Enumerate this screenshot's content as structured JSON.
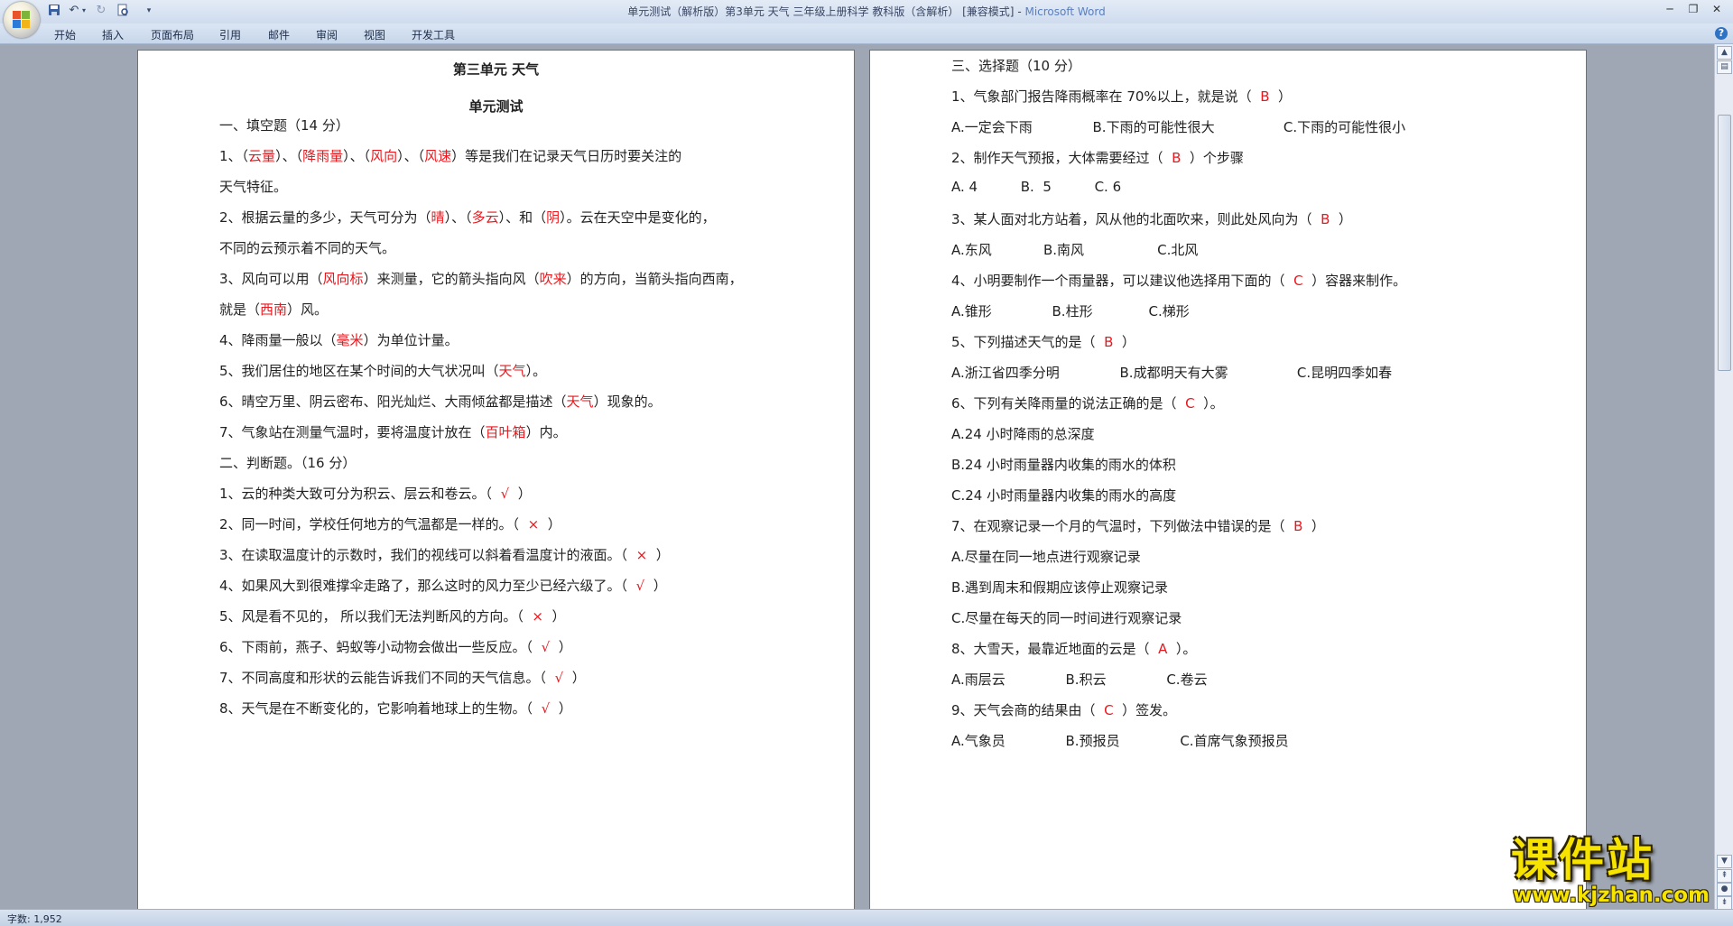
{
  "window": {
    "title": "单元测试（解析版）第3单元 天气 三年级上册科学 教科版（含解析） [兼容模式]",
    "app_name": "Microsoft Word",
    "separator": " - "
  },
  "qat": {
    "save_icon": "save-icon",
    "undo_icon": "undo-icon",
    "redo_icon": "redo-icon",
    "print_preview_icon": "print-preview-icon",
    "customize_icon": "customize-icon"
  },
  "ribbon": {
    "tabs": [
      "开始",
      "插入",
      "页面布局",
      "引用",
      "邮件",
      "审阅",
      "视图",
      "开发工具"
    ]
  },
  "status": {
    "word_count": "字数: 1,952"
  },
  "watermark": {
    "title": "课件站",
    "url": "www.kjzhan.com"
  },
  "page1": {
    "title": "第三单元  天气",
    "subtitle": "单元测试",
    "lines": [
      [
        {
          "t": "一、填空题（14 分）"
        }
      ],
      [
        {
          "t": "1、（"
        },
        {
          "t": "云量",
          "r": 1
        },
        {
          "t": "）、（"
        },
        {
          "t": "降雨量",
          "r": 1
        },
        {
          "t": "）、（"
        },
        {
          "t": "风向",
          "r": 1
        },
        {
          "t": "）、（"
        },
        {
          "t": "风速",
          "r": 1
        },
        {
          "t": "）等是我们在记录天气日历时要关注的"
        }
      ],
      [
        {
          "t": "天气特征。"
        }
      ],
      [
        {
          "t": "2、根据云量的多少，天气可分为（"
        },
        {
          "t": "晴",
          "r": 1
        },
        {
          "t": "）、（"
        },
        {
          "t": "多云",
          "r": 1
        },
        {
          "t": "）、和（"
        },
        {
          "t": "阴",
          "r": 1
        },
        {
          "t": "）。云在天空中是变化的，"
        }
      ],
      [
        {
          "t": "不同的云预示着不同的天气。"
        }
      ],
      [
        {
          "t": "3、风向可以用（"
        },
        {
          "t": "风向标",
          "r": 1
        },
        {
          "t": "）来测量，它的箭头指向风（"
        },
        {
          "t": "吹来",
          "r": 1
        },
        {
          "t": "）的方向，当箭头指向西南，"
        }
      ],
      [
        {
          "t": "就是（"
        },
        {
          "t": "西南",
          "r": 1
        },
        {
          "t": "）风。"
        }
      ],
      [
        {
          "t": "4、降雨量一般以（"
        },
        {
          "t": "毫米",
          "r": 1
        },
        {
          "t": "）为单位计量。"
        }
      ],
      [
        {
          "t": "5、我们居住的地区在某个时间的大气状况叫（"
        },
        {
          "t": "天气",
          "r": 1
        },
        {
          "t": "）。"
        }
      ],
      [
        {
          "t": "6、晴空万里、阴云密布、阳光灿烂、大雨倾盆都是描述（"
        },
        {
          "t": "天气",
          "r": 1
        },
        {
          "t": "）现象的。"
        }
      ],
      [
        {
          "t": "7、气象站在测量气温时，要将温度计放在（"
        },
        {
          "t": "百叶箱",
          "r": 1
        },
        {
          "t": "）内。"
        }
      ],
      [
        {
          "t": "二、判断题。（16 分）"
        }
      ],
      [
        {
          "t": "1、云的种类大致可分为积云、层云和卷云。（  "
        },
        {
          "t": "√",
          "r": 1
        },
        {
          "t": "  ）"
        }
      ],
      [
        {
          "t": "2、同一时间，学校任何地方的气温都是一样的。（  "
        },
        {
          "t": "×",
          "r": 1
        },
        {
          "t": "  ）"
        }
      ],
      [
        {
          "t": "3、在读取温度计的示数时，我们的视线可以斜着看温度计的液面。（  "
        },
        {
          "t": "×",
          "r": 1
        },
        {
          "t": "  ）"
        }
      ],
      [
        {
          "t": "4、如果风大到很难撑伞走路了，那么这时的风力至少已经六级了。（  "
        },
        {
          "t": "√",
          "r": 1
        },
        {
          "t": "  ）"
        }
      ],
      [
        {
          "t": "5、风是看不见的， 所以我们无法判断风的方向。（  "
        },
        {
          "t": "×",
          "r": 1
        },
        {
          "t": "  ）"
        }
      ],
      [
        {
          "t": "6、下雨前，燕子、蚂蚁等小动物会做出一些反应。（  "
        },
        {
          "t": "√",
          "r": 1
        },
        {
          "t": "  ）"
        }
      ],
      [
        {
          "t": "7、不同高度和形状的云能告诉我们不同的天气信息。（  "
        },
        {
          "t": "√",
          "r": 1
        },
        {
          "t": "  ）"
        }
      ],
      [
        {
          "t": "8、天气是在不断变化的，它影响着地球上的生物。（  "
        },
        {
          "t": "√",
          "r": 1
        },
        {
          "t": "  ）"
        }
      ]
    ]
  },
  "page2": {
    "lines": [
      [
        {
          "t": "三、选择题（10 分）"
        }
      ],
      [
        {
          "t": "1、气象部门报告降雨概率在 70%以上，就是说（  "
        },
        {
          "t": "B",
          "r": 1
        },
        {
          "t": "  ）"
        }
      ],
      [
        {
          "t": "A.一定会下雨              B.下雨的可能性很大                C.下雨的可能性很小"
        }
      ],
      [
        {
          "t": "2、制作天气预报，大体需要经过（  "
        },
        {
          "t": "B",
          "r": 1
        },
        {
          "t": "  ）个步骤"
        }
      ],
      [
        {
          "t": "A. 4          B.  5          C. 6"
        }
      ],
      [
        {
          "t": "3、某人面对北方站着，风从他的北面吹来，则此处风向为（  "
        },
        {
          "t": "B",
          "r": 1
        },
        {
          "t": "  ）"
        }
      ],
      [
        {
          "t": "A.东风            B.南风                 C.北风"
        }
      ],
      [
        {
          "t": "4、小明要制作一个雨量器，可以建议他选择用下面的（  "
        },
        {
          "t": "C",
          "r": 1
        },
        {
          "t": "  ）容器来制作。"
        }
      ],
      [
        {
          "t": "A.锥形              B.柱形             C.梯形"
        }
      ],
      [
        {
          "t": "5、下列描述天气的是（  "
        },
        {
          "t": "B",
          "r": 1
        },
        {
          "t": "  ）"
        }
      ],
      [
        {
          "t": "A.浙江省四季分明              B.成都明天有大雾                C.昆明四季如春"
        }
      ],
      [
        {
          "t": "6、下列有关降雨量的说法正确的是（  "
        },
        {
          "t": "C",
          "r": 1
        },
        {
          "t": "  ）。"
        }
      ],
      [
        {
          "t": "A.24 小时降雨的总深度"
        }
      ],
      [
        {
          "t": "B.24 小时雨量器内收集的雨水的体积"
        }
      ],
      [
        {
          "t": "C.24 小时雨量器内收集的雨水的高度"
        }
      ],
      [
        {
          "t": "7、在观察记录一个月的气温时，下列做法中错误的是（  "
        },
        {
          "t": "B",
          "r": 1
        },
        {
          "t": "  ）"
        }
      ],
      [
        {
          "t": "A.尽量在同一地点进行观察记录"
        }
      ],
      [
        {
          "t": "B.遇到周末和假期应该停止观察记录"
        }
      ],
      [
        {
          "t": "C.尽量在每天的同一时间进行观察记录"
        }
      ],
      [
        {
          "t": "8、大雪天，最靠近地面的云是（  "
        },
        {
          "t": "A",
          "r": 1
        },
        {
          "t": "  ）。"
        }
      ],
      [
        {
          "t": "A.雨层云              B.积云              C.卷云"
        }
      ],
      [
        {
          "t": "9、天气会商的结果由（  "
        },
        {
          "t": "C",
          "r": 1
        },
        {
          "t": "  ）签发。"
        }
      ],
      [
        {
          "t": "A.气象员              B.预报员              C.首席气象预报员"
        }
      ]
    ]
  },
  "colors": {
    "answer": "#e8181e",
    "text": "#222222",
    "workspace": "#9fa7b4",
    "app_name": "#5a7fc0"
  }
}
